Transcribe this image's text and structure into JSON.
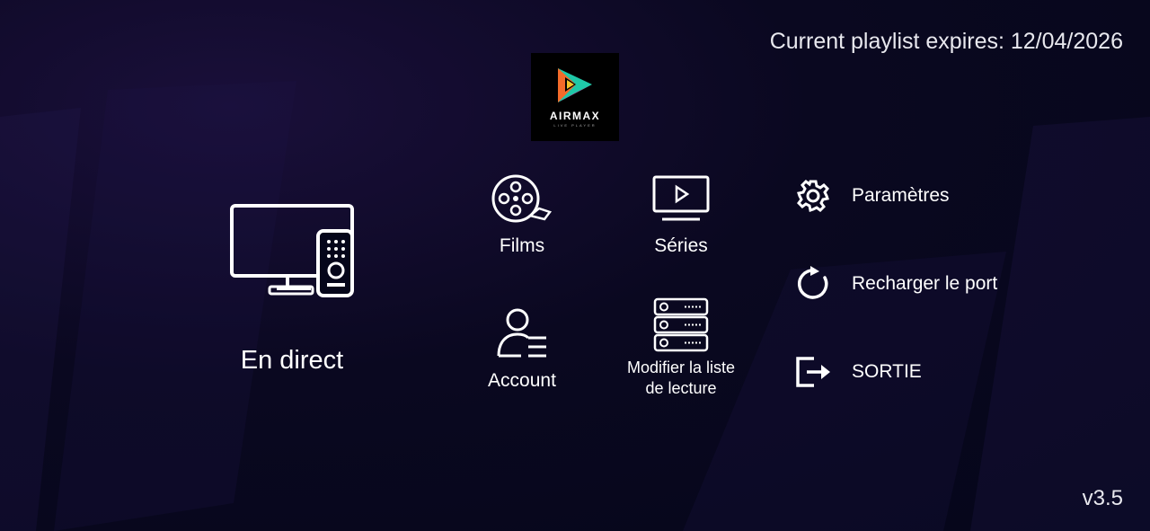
{
  "header": {
    "expiry_text": "Current playlist expires: 12/04/2026"
  },
  "logo": {
    "name": "AIRMAX",
    "subtitle": "LIVE PLAYER"
  },
  "tiles": {
    "live": {
      "label": "En direct",
      "icon": "tv-remote-icon"
    },
    "films": {
      "label": "Films",
      "icon": "film-reel-icon"
    },
    "series": {
      "label": "Séries",
      "icon": "tv-play-icon"
    },
    "account": {
      "label": "Account",
      "icon": "user-list-icon"
    },
    "playlist": {
      "label_line1": "Modifier la liste",
      "label_line2": "de lecture",
      "icon": "server-stack-icon"
    }
  },
  "menu": {
    "settings": {
      "label": "Paramètres",
      "icon": "gear-icon"
    },
    "reload": {
      "label": "Recharger le port",
      "icon": "reload-icon"
    },
    "exit": {
      "label": "SORTIE",
      "icon": "exit-icon"
    }
  },
  "footer": {
    "version": "v3.5"
  },
  "colors": {
    "background": "#05061a",
    "accent": "#1a0f3a",
    "text": "#ffffff"
  }
}
